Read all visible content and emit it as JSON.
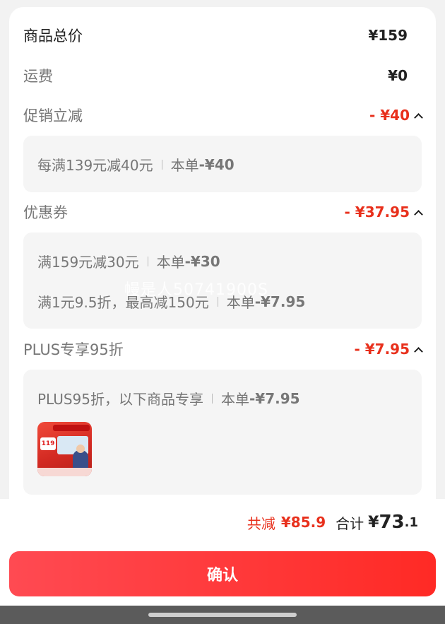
{
  "total_price": {
    "label": "商品总价",
    "value": "¥159"
  },
  "shipping": {
    "label": "运费",
    "value": "¥0"
  },
  "promo": {
    "label": "促销立减",
    "value": "- ¥40",
    "items": [
      {
        "desc": "每满139元减40元",
        "prefix": "本单 ",
        "amount": "-¥40"
      }
    ]
  },
  "coupon": {
    "label": "优惠券",
    "value": "- ¥37.95",
    "items": [
      {
        "desc": "满159元减30元",
        "prefix": "本单 ",
        "amount": "-¥30"
      },
      {
        "desc": "满1元9.5折，最高减150元",
        "prefix": "本单 ",
        "amount": "-¥7.95"
      }
    ]
  },
  "plus": {
    "label": "PLUS专享95折",
    "value": "- ¥7.95",
    "items": [
      {
        "desc": "PLUS95折，以下商品专享",
        "prefix": "本单",
        "amount": "-¥7.95"
      }
    ],
    "product_badge": "119"
  },
  "watermark": "幔是人50741900S",
  "summary": {
    "saved_label": "共减",
    "saved_value": "¥85.9",
    "total_label": "合计",
    "total_symbol": "¥",
    "total_int": "73",
    "total_dec": ".1"
  },
  "confirm_label": "确认",
  "colors": {
    "accent": "#e8301c",
    "button_start": "#ff4a52",
    "button_end": "#ff2a25"
  }
}
